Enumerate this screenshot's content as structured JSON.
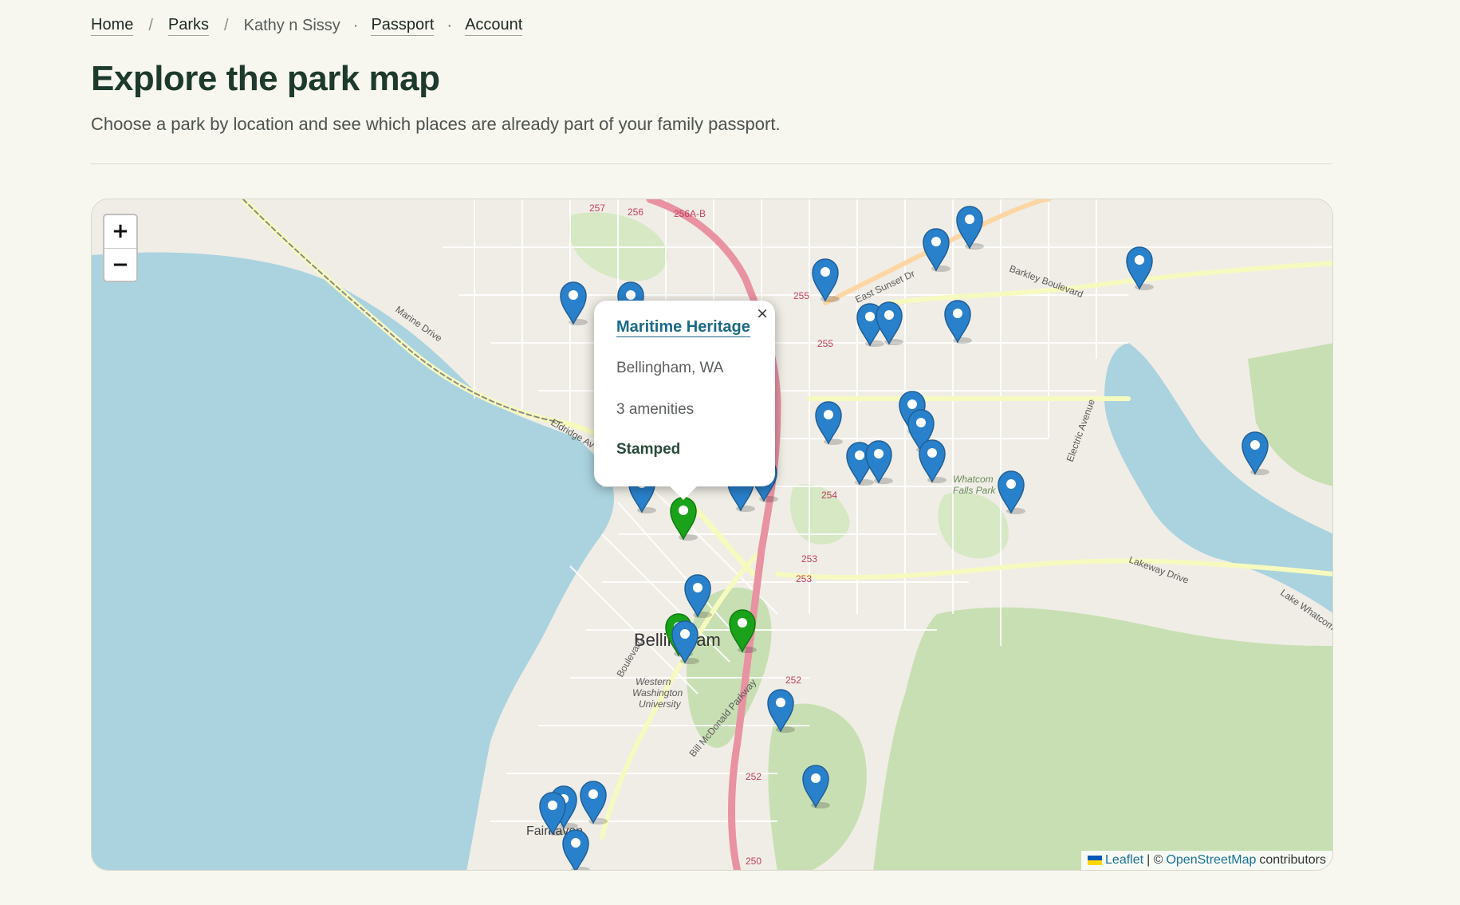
{
  "breadcrumb": {
    "items": [
      {
        "label": "Home",
        "link": true
      },
      {
        "label": "Parks",
        "link": true
      },
      {
        "label": "Kathy n Sissy",
        "link": false
      },
      {
        "label": "Passport",
        "link": true
      },
      {
        "label": "Account",
        "link": true
      }
    ]
  },
  "page": {
    "title": "Explore the park map",
    "subtitle": "Choose a park by location and see which places are already part of your family passport."
  },
  "map": {
    "zoom_in": "+",
    "zoom_out": "−",
    "city_label": "Bellingham",
    "labels": [
      "Marine Drive",
      "Eldridge Av",
      "Boulevard",
      "Western Washington University",
      "Bill McDonald Parkway",
      "Lakeway Drive",
      "East Sunset Dr",
      "Barkley Boulevard",
      "Electric Avenue",
      "Whatcom Falls Park",
      "Fairhaven",
      "Lake Whatcom",
      "256",
      "257",
      "256A-B",
      "255",
      "254",
      "253",
      "252",
      "250"
    ],
    "colors": {
      "unstamped": "#2a81cb",
      "stamped": "#1aa31a"
    },
    "popup": {
      "close": "×",
      "name": "Maritime Heritage",
      "location": "Bellingham, WA",
      "amenities": "3 amenities",
      "status": "Stamped"
    },
    "attribution": {
      "leaflet": "Leaflet",
      "separator": "| ©",
      "osm": "OpenStreetMap",
      "suffix": "contributors"
    }
  }
}
